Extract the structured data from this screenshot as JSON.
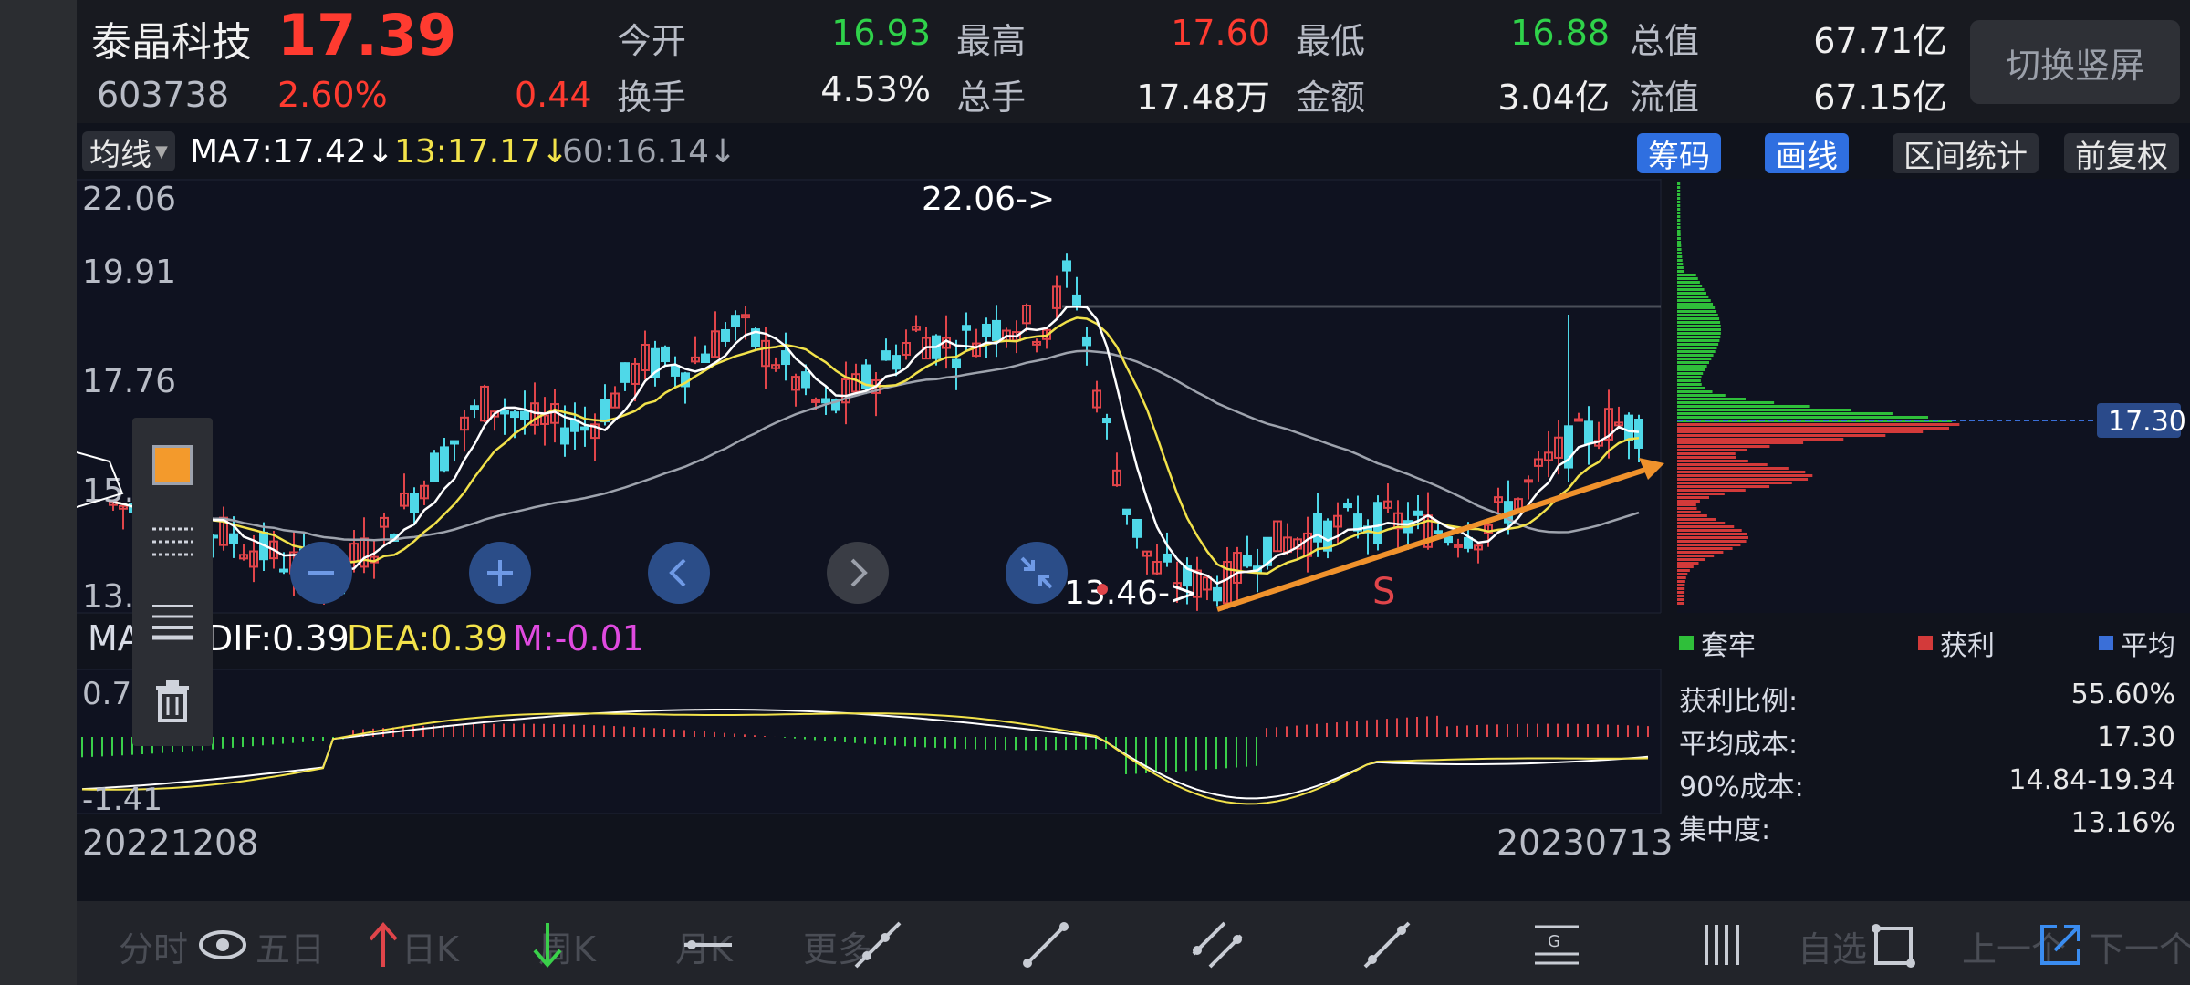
{
  "quote": {
    "name": "泰晶科技",
    "price": "17.39",
    "code": "603738",
    "pct": "2.60%",
    "change": "0.44",
    "fields": [
      {
        "label": "今开",
        "value": "16.93",
        "color": "#2fd24a"
      },
      {
        "label": "最高",
        "value": "17.60",
        "color": "#ff3b30"
      },
      {
        "label": "最低",
        "value": "16.88",
        "color": "#2fd24a"
      },
      {
        "label": "总值",
        "value": "67.71亿",
        "color": "#f0f0f0"
      },
      {
        "label": "换手",
        "value": "4.53%",
        "color": "#f0f0f0"
      },
      {
        "label": "总手",
        "value": "17.48万",
        "color": "#f0f0f0"
      },
      {
        "label": "金额",
        "value": "3.04亿",
        "color": "#f0f0f0"
      },
      {
        "label": "流值",
        "value": "67.15亿",
        "color": "#f0f0f0"
      }
    ],
    "switch_label": "切换竖屏"
  },
  "ma_bar": {
    "dropdown": "均线",
    "ma7": "MA7:17.42↓",
    "ma13": "13:17.17↓",
    "ma60": "60:16.14↓",
    "tags": [
      "筹码",
      "画线",
      "区间统计",
      "前复权"
    ]
  },
  "chart": {
    "y_labels": [
      "22.06",
      "19.91",
      "17.76",
      "15.",
      "13.4"
    ],
    "high_annotation": "22.06->",
    "low_annotation": "13.46->",
    "s_mark": "S",
    "chip_price": "17.30",
    "macd_name": "MACD",
    "macd_dif": "DIF:0.39",
    "macd_dea": "DEA:0.39",
    "macd_m": "M:-0.01",
    "macd_top": "0.74",
    "macd_bottom": "-1.41",
    "date_start": "20221208",
    "date_end": "20230713"
  },
  "chip": {
    "legend": [
      {
        "label": "套牢",
        "color": "#2fbf3a"
      },
      {
        "label": "获利",
        "color": "#d33a3a"
      },
      {
        "label": "平均",
        "color": "#3a6fd8"
      }
    ],
    "stats": [
      {
        "label": "获利比例:",
        "value": "55.60%"
      },
      {
        "label": "平均成本:",
        "value": "17.30"
      },
      {
        "label": "90%成本:",
        "value": "14.84-19.34"
      },
      {
        "label": "集中度:",
        "value": "13.16%"
      }
    ]
  },
  "bottom_tabs": [
    "分时",
    "五日",
    "日K",
    "周K",
    "月K",
    "更多",
    "自选",
    "上一个",
    "下一个"
  ],
  "colors": {
    "up": "#e0454a",
    "down": "#4fd8e8",
    "ma7": "#ffffff",
    "ma13": "#f2e24a",
    "ma60": "#9ea3ad",
    "accent": "#f0922c"
  }
}
